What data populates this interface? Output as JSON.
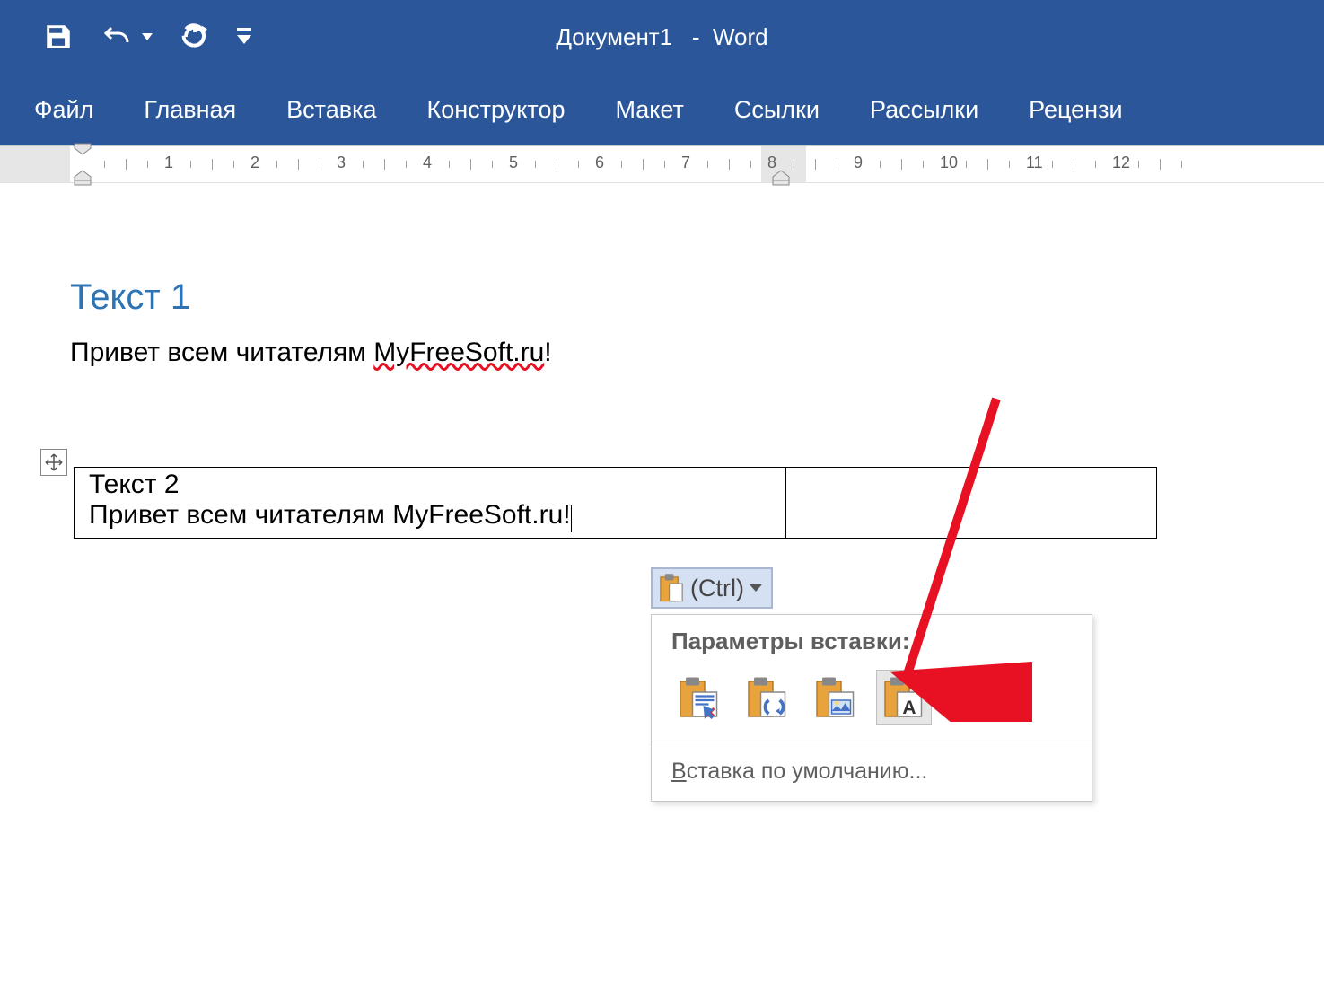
{
  "title": {
    "doc": "Документ1",
    "sep": "-",
    "app": "Word"
  },
  "menu": {
    "file": "Файл",
    "home": "Главная",
    "insert": "Вставка",
    "design": "Конструктор",
    "layout": "Макет",
    "references": "Ссылки",
    "mailings": "Рассылки",
    "review": "Рецензи"
  },
  "ruler": {
    "numbers": [
      "1",
      "2",
      "3",
      "4",
      "5",
      "6",
      "7",
      "8",
      "9",
      "10",
      "11",
      "12"
    ]
  },
  "doc": {
    "heading": "Текст 1",
    "para_pre": "Привет всем читателям ",
    "para_spell": "MyFreeSoft.ru",
    "para_post": "!",
    "table_heading": "Текст 2",
    "table_para": "Привет всем читателям MyFreeSoft.ru!"
  },
  "paste": {
    "btn_label": "(Ctrl)",
    "menu_header": "Параметры вставки:",
    "default_label_pre": "В",
    "default_label_rest": "ставка по умолчанию..."
  },
  "icons": {
    "save": "save-icon",
    "undo": "undo-icon",
    "redo": "redo-icon",
    "customize": "customize-icon",
    "clipboard": "clipboard-icon",
    "move": "move-icon",
    "dropdown": "dropdown-icon",
    "paste_keep": "paste-keep-source-icon",
    "paste_merge": "paste-merge-icon",
    "paste_picture": "paste-picture-icon",
    "paste_text": "paste-text-only-icon"
  }
}
